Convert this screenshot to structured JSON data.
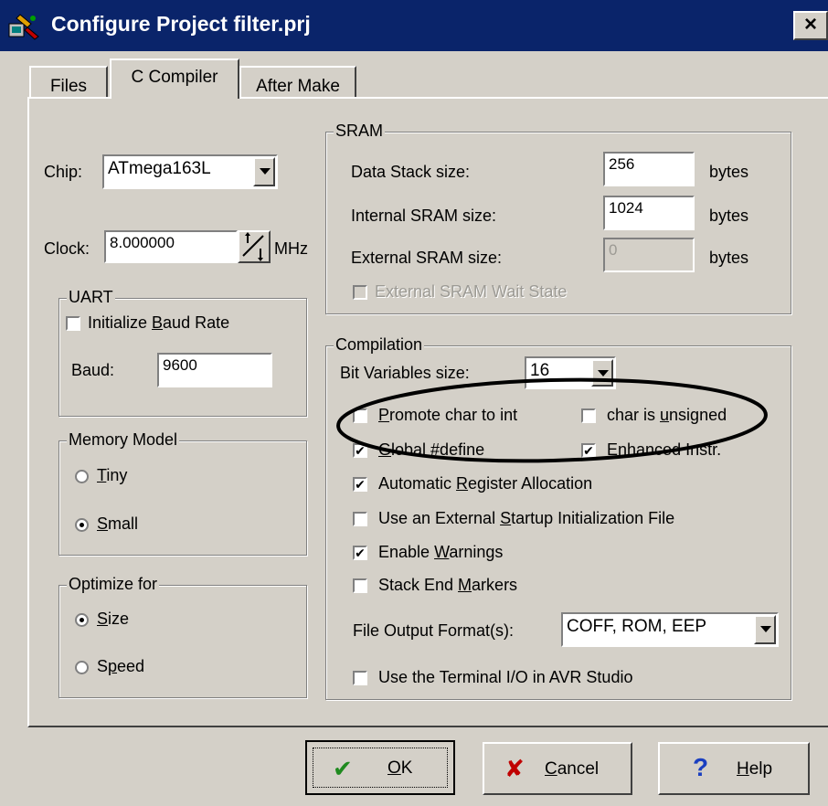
{
  "window": {
    "title": "Configure Project filter.prj",
    "close": "×"
  },
  "tabs": [
    {
      "label": "Files"
    },
    {
      "label": "C Compiler"
    },
    {
      "label": "After Make"
    }
  ],
  "chip": {
    "label": "Chip:",
    "value": "ATmega163L"
  },
  "clock": {
    "label": "Clock:",
    "value": "8.000000",
    "unit": "MHz"
  },
  "uart": {
    "title": "UART",
    "init_baud": {
      "label": "Initialize Baud Rate",
      "checked": false
    },
    "baud_label": "Baud:",
    "baud_value": "9600"
  },
  "memory_model": {
    "title": "Memory Model",
    "options": [
      {
        "label": "Tiny",
        "selected": false
      },
      {
        "label": "Small",
        "selected": true
      }
    ]
  },
  "optimize": {
    "title": "Optimize for",
    "options": [
      {
        "label": "Size",
        "selected": true
      },
      {
        "label": "Speed",
        "selected": false
      }
    ]
  },
  "sram": {
    "title": "SRAM",
    "rows": [
      {
        "label": "Data Stack size:",
        "value": "256",
        "unit": "bytes",
        "enabled": true
      },
      {
        "label": "Internal SRAM size:",
        "value": "1024",
        "unit": "bytes",
        "enabled": true
      },
      {
        "label": "External SRAM size:",
        "value": "0",
        "unit": "bytes",
        "enabled": false
      }
    ],
    "wait_state": {
      "label": "External SRAM Wait State",
      "checked": false,
      "enabled": false
    }
  },
  "compilation": {
    "title": "Compilation",
    "bitvar_label": "Bit Variables size:",
    "bitvar_value": "16",
    "promote": {
      "label": "Promote char to int",
      "checked": false
    },
    "unsigned": {
      "label": "char is unsigned",
      "checked": false
    },
    "global_define": {
      "label": "Global #define",
      "checked": true
    },
    "enhanced": {
      "label": "Enhanced Instr.",
      "checked": true
    },
    "auto_reg": {
      "label": "Automatic Register Allocation",
      "checked": true
    },
    "ext_startup": {
      "label": "Use an External Startup Initialization File",
      "checked": false
    },
    "warnings": {
      "label": "Enable Warnings",
      "checked": true
    },
    "stack_end": {
      "label": "Stack End Markers",
      "checked": false
    },
    "output_label": "File Output Format(s):",
    "output_value": "COFF, ROM, EEP",
    "terminal": {
      "label": "Use the Terminal I/O in AVR Studio",
      "checked": false
    }
  },
  "buttons": {
    "ok": {
      "label": "OK",
      "icon": "check-icon",
      "color": "#1f8a1f"
    },
    "cancel": {
      "label": "Cancel",
      "icon": "x-icon",
      "color": "#c00000"
    },
    "help": {
      "label": "Help",
      "icon": "question-icon",
      "color": "#1a3fc0"
    }
  },
  "colors": {
    "title_bar": "#0a246a",
    "face": "#d4d0c8",
    "annotation": "#000000"
  }
}
